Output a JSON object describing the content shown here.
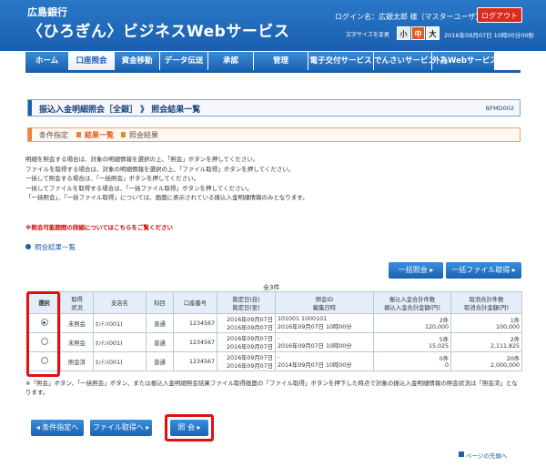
{
  "header": {
    "bank_name": "広島銀行",
    "service_name": "〈ひろぎん〉ビジネスWebサービス",
    "login_user": "ログイン名：広銀太郎 様（マスターユーザ）",
    "logout_label": "ログアウト",
    "font_size_label": "文字サイズを変更",
    "font_sizes": [
      "小",
      "中",
      "大"
    ],
    "datetime": "2016年09月07日 10時00分00秒"
  },
  "nav": {
    "items": [
      "ホーム",
      "口座照会",
      "資金移動",
      "データ伝送",
      "承認",
      "管理",
      "電子交付サービス",
      "でんさいサービス",
      "外為Webサービス"
    ],
    "active_index": 1
  },
  "page": {
    "title": "振込入金明細照会［全銀］ 》 照会結果一覧",
    "screen_id": "BFMD002"
  },
  "steps": [
    "条件指定",
    "結果一覧",
    "照会結果"
  ],
  "instructions": [
    "明細を照会する場合は、対象の明細情報を選択の上、「照会」ボタンを押してください。",
    "ファイルを取得する場合は、対象の明細情報を選択の上、「ファイル取得」ボタンを押してください。",
    "一括して照会する場合は、「一括照会」ボタンを押してください。",
    "一括してファイルを取得する場合は、「一括ファイル取得」ボタンを押してください。",
    "「一括照会」、「一括ファイル取得」については、画面に表示されている振込入金明細情報のみとなります。"
  ],
  "warning": "※照会可能期間の詳細についてはこちらをご覧ください",
  "section_title": "照会結果一覧",
  "buttons": {
    "bulk_inquiry": "一括照会 ▸",
    "bulk_file": "一括ファイル取得 ▸",
    "back": "◂ 条件指定へ",
    "file_get": "ファイル取得へ ▸",
    "inquiry": "照 会 ▸"
  },
  "result_count": "全3件",
  "table": {
    "headers": [
      "選択",
      "取得\n状況",
      "支店名",
      "科目",
      "口座番号",
      "勘定日(自)\n勘定日(至)",
      "照会ID\n編集日時",
      "振込入金合計件数\n振込入金合計金額(円)",
      "取消合計件数\n取消合計金額(円)"
    ],
    "rows": [
      {
        "selected": true,
        "status": "未照会",
        "branch": "ﾎﾝﾃﾝ(001)",
        "subject": "普通",
        "account": "1234567",
        "date_from": "2016年09月07日",
        "date_to": "2016年09月07日",
        "inquiry_id": "101001 1000101",
        "edit_datetime": "2016年09月07日 10時00分",
        "in_count": "2件",
        "in_amount": "120,000",
        "cancel_count": "1件",
        "cancel_amount": "100,000"
      },
      {
        "selected": false,
        "status": "未照会",
        "branch": "ﾎﾝﾃﾝ(001)",
        "subject": "普通",
        "account": "1234567",
        "date_from": "2016年09月07日",
        "date_to": "2016年09月07日",
        "inquiry_id": "-",
        "edit_datetime": "2016年09月07日 10時00分",
        "in_count": "5件",
        "in_amount": "15,025",
        "cancel_count": "2件",
        "cancel_amount": "2,111,825"
      },
      {
        "selected": false,
        "status": "照会済",
        "branch": "ﾎﾝﾃﾝ(001)",
        "subject": "普通",
        "account": "1234567",
        "date_from": "2016年09月07日",
        "date_to": "2016年09月07日",
        "inquiry_id": "-",
        "edit_datetime": "2014年09月07日 10時00分",
        "in_count": "0件",
        "in_amount": "0",
        "cancel_count": "20件",
        "cancel_amount": "2,000,000"
      }
    ]
  },
  "note": "※「照会」ボタン、「一括照会」ボタン、または振込入金明細照会結果ファイル取得画面の「ファイル取得」ボタンを押下した時点で対象の振込入金明細情報の照会状況は「照会済」となります。",
  "page_top": "ページの先頭へ"
}
